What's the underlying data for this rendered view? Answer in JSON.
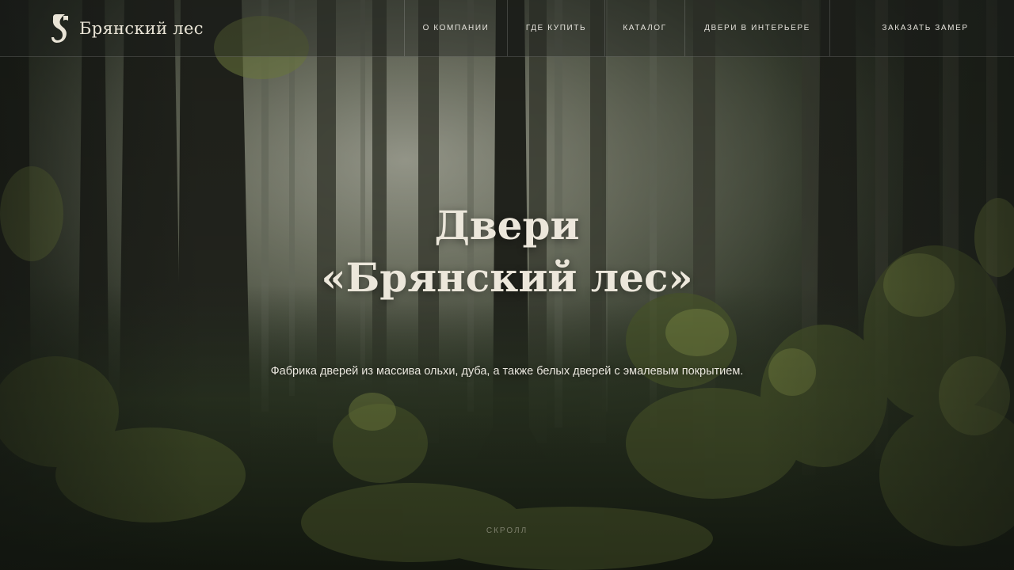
{
  "header": {
    "logo_text": "Брянский лес",
    "logo_icon": "stylized-s-leaf-logo",
    "nav": [
      {
        "label": "О КОМПАНИИ"
      },
      {
        "label": "ГДЕ КУПИТЬ"
      },
      {
        "label": "КАТАЛОГ"
      },
      {
        "label": "ДВЕРИ В ИНТЕРЬЕРЕ"
      }
    ],
    "cta_label": "ЗАКАЗАТЬ ЗАМЕР"
  },
  "hero": {
    "title_line1": "Двери",
    "title_line2": "«Брянский лес»",
    "subtitle": "Фабрика дверей из массива ольхи, дуба, а также белых дверей с эмалевым покрытием.",
    "scroll_label": "СКРОЛЛ"
  },
  "colors": {
    "text_light": "#ece7db",
    "header_overlay": "#1e201c",
    "forest_dark": "#1f231c"
  }
}
